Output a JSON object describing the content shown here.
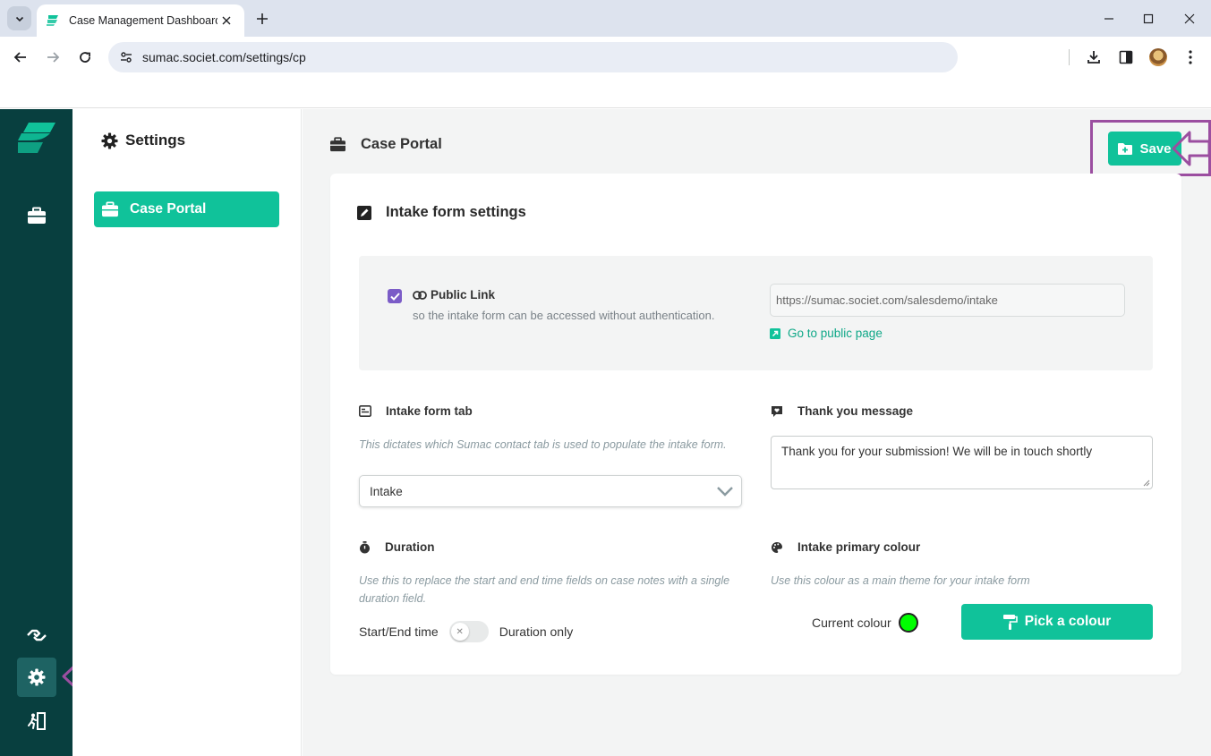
{
  "browser": {
    "tab_title": "Case Management Dashboard",
    "url": "sumac.societ.com/settings/cp"
  },
  "sidebar": {
    "title": "Settings",
    "items": [
      {
        "label": "Case Portal",
        "icon": "briefcase-icon"
      }
    ]
  },
  "header": {
    "title": "Case Portal",
    "save_label": "Save"
  },
  "card": {
    "title": "Intake form settings",
    "public_link": {
      "checked": true,
      "title": "Public Link",
      "subtitle": "so the intake form can be accessed without authentication.",
      "url_value": "https://sumac.societ.com/salesdemo/intake",
      "go_label": "Go to public page"
    },
    "intake_tab": {
      "label": "Intake form tab",
      "hint": "This dictates which Sumac contact tab is used to populate the intake form.",
      "selected": "Intake"
    },
    "thank_you": {
      "label": "Thank you message",
      "value": "Thank you for your submission! We will be in touch shortly"
    },
    "duration": {
      "label": "Duration",
      "hint": "Use this to replace the start and end time fields on case notes with a single duration field.",
      "left_label": "Start/End time",
      "right_label": "Duration only",
      "enabled": false
    },
    "colour": {
      "label": "Intake primary colour",
      "hint": "Use this colour as a main theme for your intake form",
      "current_label": "Current colour",
      "current_value": "#00ff00",
      "pick_label": "Pick a colour"
    }
  },
  "colors": {
    "accent": "#10c29a",
    "rail": "#083f3f",
    "highlight": "#9b4ea0",
    "checkbox": "#7b5cc7"
  }
}
